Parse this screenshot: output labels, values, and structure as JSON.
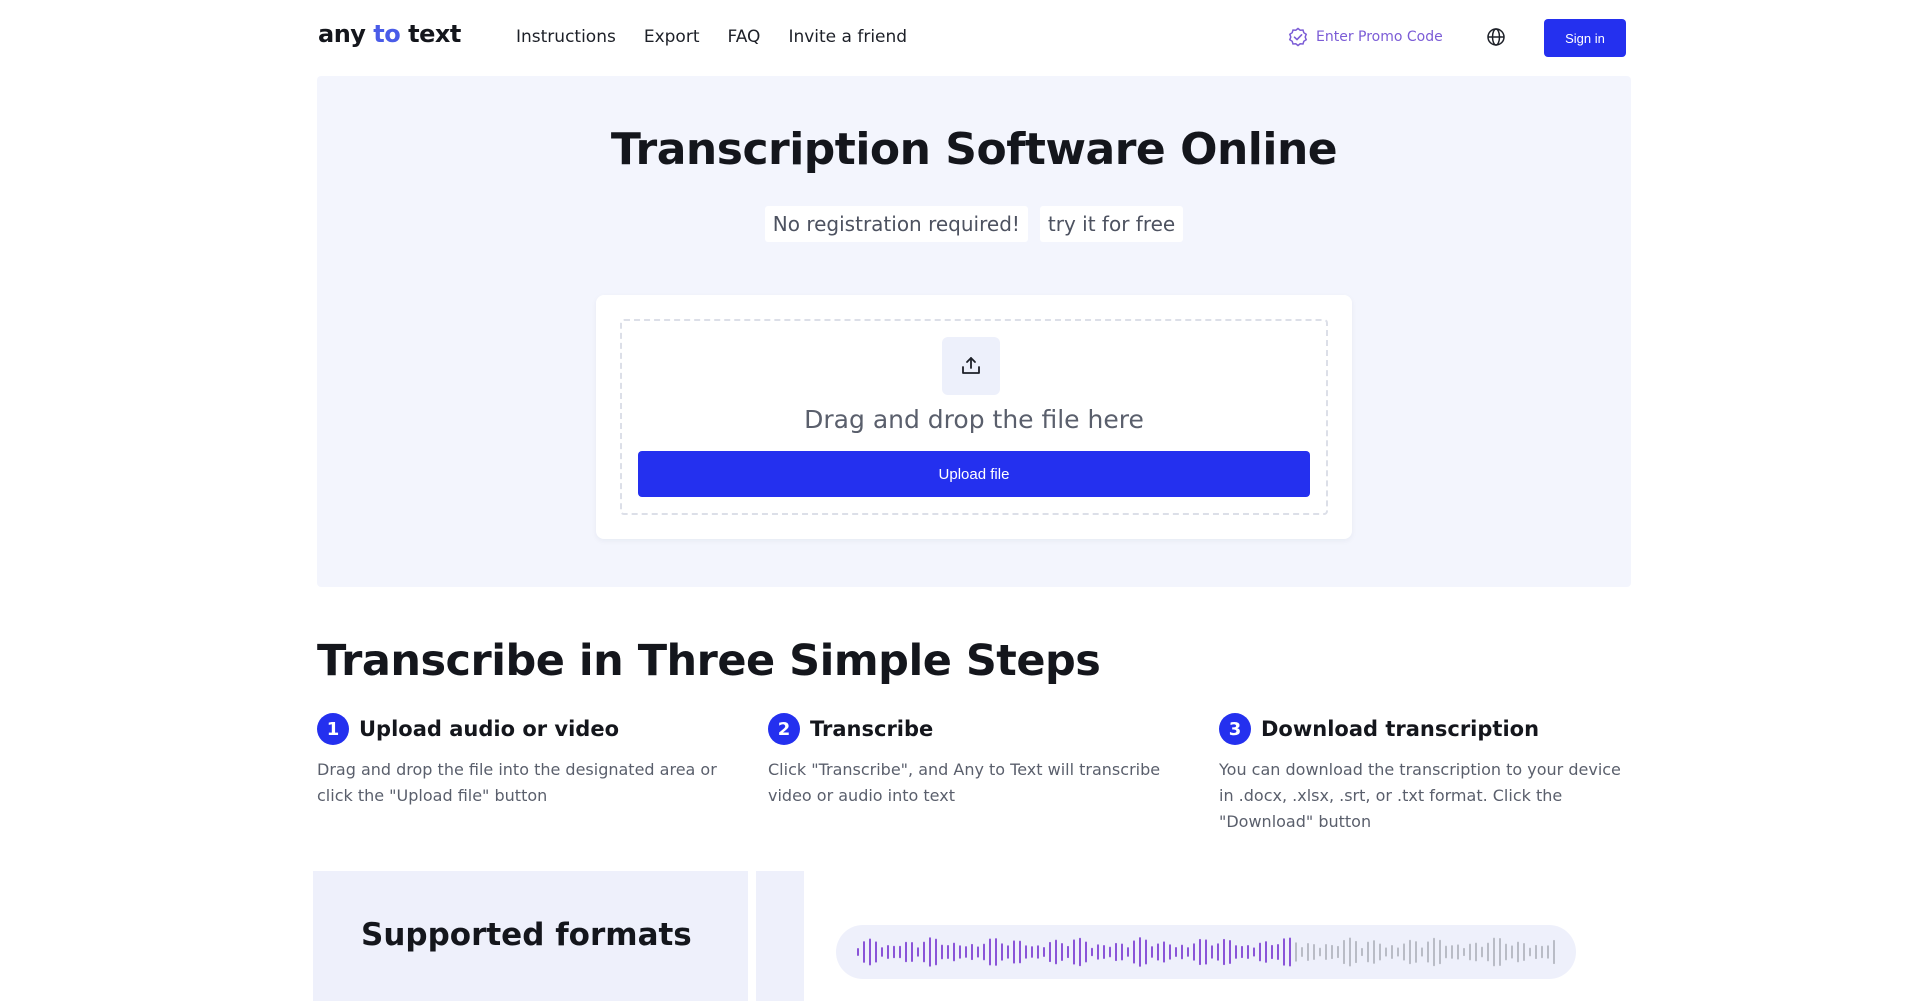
{
  "header": {
    "logo": {
      "part1": "any",
      "part2": "to",
      "part3": "text"
    },
    "nav": [
      "Instructions",
      "Export",
      "FAQ",
      "Invite a friend"
    ],
    "promo_label": "Enter Promo Code",
    "signin_label": "Sign in"
  },
  "hero": {
    "title": "Transcription Software Online",
    "chips": [
      "No registration required!",
      "try it for free"
    ],
    "drop_text": "Drag and drop the file here",
    "upload_label": "Upload file"
  },
  "steps": {
    "title": "Transcribe in Three Simple Steps",
    "items": [
      {
        "num": "1",
        "title": "Upload audio or video",
        "text": "Drag and drop the file into the designated area or click the \"Upload file\" button"
      },
      {
        "num": "2",
        "title": "Transcribe",
        "text": "Click \"Transcribe\", and Any to Text will transcribe video or audio into text"
      },
      {
        "num": "3",
        "title": "Download transcription",
        "text": "You can download the transcription to your device in .docx, .xlsx, .srt, or .txt format. Click the \"Download\" button"
      }
    ]
  },
  "formats": {
    "title": "Supported formats"
  },
  "colors": {
    "accent": "#2430ef",
    "wave_played": "#8a54d8",
    "wave_unplayed": "#b9bcc6",
    "promo": "#7b5cd6"
  }
}
